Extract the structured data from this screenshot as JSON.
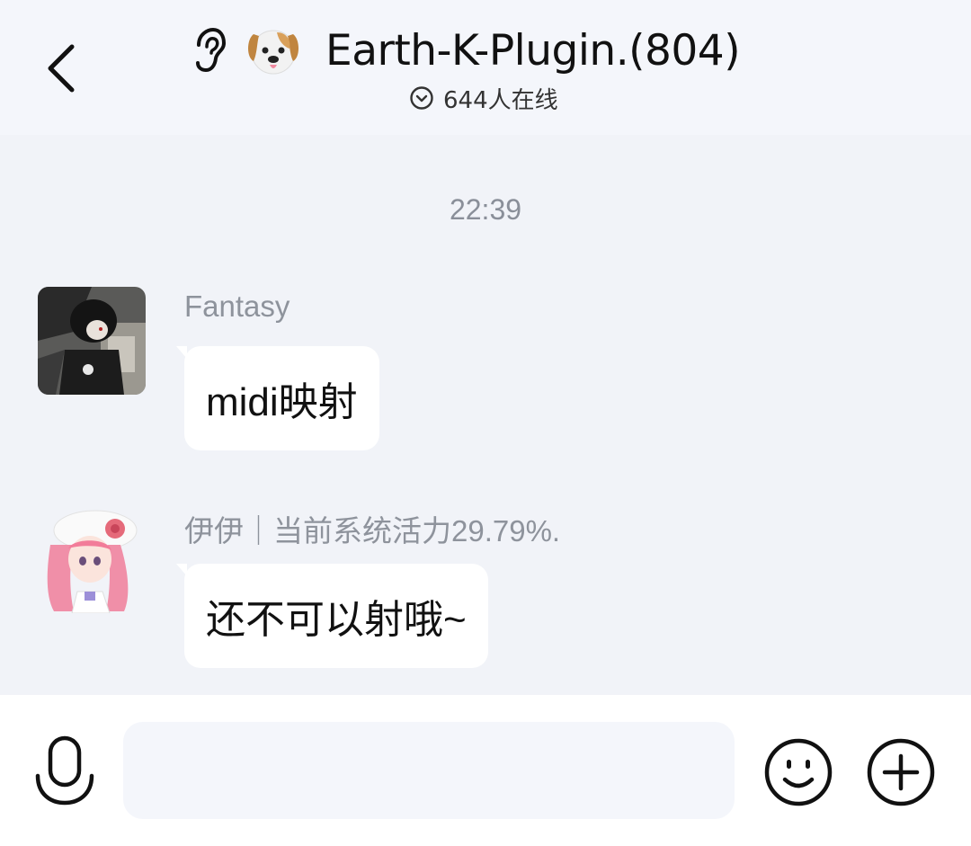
{
  "header": {
    "title": "Earth-K-Plugin.(804)",
    "online": "644人在线",
    "icons": {
      "back": "back-chevron-icon",
      "ear": "ear-icon",
      "dog": "dog-face-icon",
      "chevron": "chevron-down-circle-icon"
    }
  },
  "chat": {
    "timestamp": "22:39",
    "messages": [
      {
        "sender": "Fantasy",
        "text": "midi映射",
        "avatar": "avatar-dark-character"
      },
      {
        "sender": "伊伊｜当前系统活力29.79%.",
        "text": "还不可以射哦~",
        "avatar": "avatar-pink-hair-character"
      }
    ]
  },
  "composer": {
    "input_value": "",
    "input_placeholder": "",
    "icons": {
      "mic": "microphone-icon",
      "emoji": "smiley-icon",
      "plus": "plus-circle-icon"
    }
  },
  "colors": {
    "background": "#F1F3F8",
    "header": "#F4F6FB",
    "bubble": "#FFFFFF",
    "muted_text": "#8E939C"
  }
}
